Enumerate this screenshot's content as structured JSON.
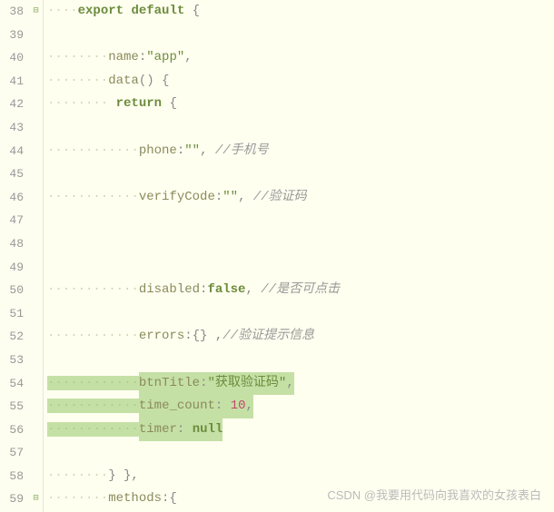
{
  "gutter": {
    "start": 38,
    "end": 59
  },
  "fold": {
    "38": "⊟",
    "59": "⊟"
  },
  "lines": {
    "38": {
      "indent": 1,
      "tokens": [
        [
          "kw",
          "export"
        ],
        [
          "punct",
          " "
        ],
        [
          "kw",
          "default"
        ],
        [
          "punct",
          " {"
        ]
      ]
    },
    "39": {
      "indent": 0,
      "tokens": []
    },
    "40": {
      "indent": 2,
      "tokens": [
        [
          "ident",
          "name"
        ],
        [
          "punct",
          ":"
        ],
        [
          "str",
          "\"app\""
        ],
        [
          "punct",
          ","
        ]
      ]
    },
    "41": {
      "indent": 2,
      "tokens": [
        [
          "ident",
          "data"
        ],
        [
          "punct",
          "() {"
        ]
      ]
    },
    "42": {
      "indent": 2,
      "tokens": [
        [
          "punct",
          " "
        ],
        [
          "kw",
          "return"
        ],
        [
          "punct",
          " {"
        ]
      ]
    },
    "43": {
      "indent": 0,
      "tokens": []
    },
    "44": {
      "indent": 3,
      "tokens": [
        [
          "ident",
          "phone"
        ],
        [
          "punct",
          ":"
        ],
        [
          "str",
          "\"\""
        ],
        [
          "punct",
          ", "
        ],
        [
          "comment",
          "//手机号"
        ]
      ]
    },
    "45": {
      "indent": 0,
      "tokens": []
    },
    "46": {
      "indent": 3,
      "tokens": [
        [
          "ident",
          "verifyCode"
        ],
        [
          "punct",
          ":"
        ],
        [
          "str",
          "\"\""
        ],
        [
          "punct",
          ", "
        ],
        [
          "comment",
          "//验证码"
        ]
      ]
    },
    "47": {
      "indent": 0,
      "tokens": []
    },
    "48": {
      "indent": 0,
      "tokens": []
    },
    "49": {
      "indent": 0,
      "tokens": []
    },
    "50": {
      "indent": 3,
      "tokens": [
        [
          "ident",
          "disabled"
        ],
        [
          "punct",
          ":"
        ],
        [
          "bool",
          "false"
        ],
        [
          "punct",
          ", "
        ],
        [
          "comment",
          "//是否可点击"
        ]
      ]
    },
    "51": {
      "indent": 0,
      "tokens": []
    },
    "52": {
      "indent": 3,
      "tokens": [
        [
          "ident",
          "errors"
        ],
        [
          "punct",
          ":{} ,"
        ],
        [
          "comment",
          "//验证提示信息"
        ]
      ]
    },
    "53": {
      "indent": 0,
      "tokens": []
    },
    "54": {
      "indent": 3,
      "tokens": [
        [
          "ident",
          "btnTitle"
        ],
        [
          "punct",
          ":"
        ],
        [
          "str",
          "\"获取验证码\""
        ],
        [
          "punct",
          ","
        ]
      ],
      "highlight": true
    },
    "55": {
      "indent": 3,
      "tokens": [
        [
          "ident",
          "time_count"
        ],
        [
          "punct",
          ": "
        ],
        [
          "num",
          "10"
        ],
        [
          "punct",
          ","
        ]
      ],
      "highlight": true
    },
    "56": {
      "indent": 3,
      "tokens": [
        [
          "ident",
          "timer"
        ],
        [
          "punct",
          ": "
        ],
        [
          "null",
          "null"
        ]
      ],
      "highlight": true
    },
    "57": {
      "indent": 0,
      "tokens": []
    },
    "58": {
      "indent": 2,
      "tokens": [
        [
          "punct",
          "} },"
        ]
      ]
    },
    "59": {
      "indent": 2,
      "tokens": [
        [
          "ident",
          "methods"
        ],
        [
          "punct",
          ":{"
        ]
      ]
    }
  },
  "watermark": "CSDN @我要用代码向我喜欢的女孩表白"
}
